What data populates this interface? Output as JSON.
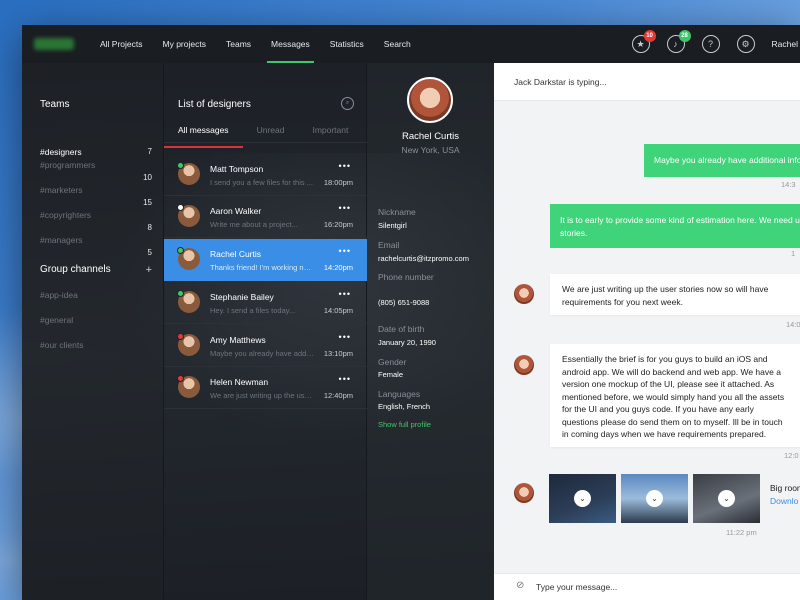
{
  "nav": {
    "items": [
      "All Projects",
      "My projects",
      "Teams",
      "Messages",
      "Statistics",
      "Search"
    ],
    "active_index": 3,
    "badges": {
      "star": "10",
      "bell": "28"
    },
    "badge_colors": {
      "star": "#e53935",
      "bell": "#3ec76a"
    },
    "icons": [
      "star-icon",
      "bell-icon",
      "help-icon",
      "settings-icon"
    ],
    "user": "Rachel"
  },
  "teams": {
    "title": "Teams",
    "items": [
      {
        "name": "#designers",
        "count": "7"
      },
      {
        "name": "#programmers",
        "count": "10"
      },
      {
        "name": "#marketers",
        "count": "15"
      },
      {
        "name": "#copyrighters",
        "count": "8"
      },
      {
        "name": "#managers",
        "count": "5"
      }
    ],
    "active_index": 0,
    "group_title": "Group channels",
    "channels": [
      "#app-idea",
      "#general",
      "#our clients"
    ]
  },
  "designers": {
    "title": "List of designers",
    "tabs": [
      "All messages",
      "Unread",
      "Important"
    ],
    "messages": [
      {
        "name": "Matt Tompson",
        "preview": "I send you a few files for this ...",
        "time": "18:00pm",
        "status": "#3ec76a"
      },
      {
        "name": "Aaron Walker",
        "preview": "Write me about a project...",
        "time": "16:20pm",
        "status": "#ffffff"
      },
      {
        "name": "Rachel Curtis",
        "preview": "Thanks friend! I'm working now...",
        "time": "14:20pm",
        "status": "#3ec76a"
      },
      {
        "name": "Stephanie Bailey",
        "preview": "Hey. I send a files today...",
        "time": "14:05pm",
        "status": "#3ec76a"
      },
      {
        "name": "Amy Matthews",
        "preview": "Maybe you already have addit...",
        "time": "13:10pm",
        "status": "#e53935"
      },
      {
        "name": "Helen Newman",
        "preview": "We are just writing up the user...",
        "time": "12:40pm",
        "status": "#e53935"
      }
    ],
    "active_index": 2
  },
  "profile": {
    "name": "Rachel Curtis",
    "location": "New York, USA",
    "fields": [
      {
        "label": "Nickname",
        "value": "Silentgirl"
      },
      {
        "label": "Email",
        "value": "rachelcurtis@itzpromo.com"
      },
      {
        "label": "Phone number",
        "value": "(805) 651-9088"
      },
      {
        "label": "Date of birth",
        "value": "January 20, 1990"
      },
      {
        "label": "Gender",
        "value": "Female"
      },
      {
        "label": "Languages",
        "value": "English, French"
      }
    ],
    "link": "Show full profile"
  },
  "chat": {
    "typing": "Jack Darkstar is typing...",
    "out1": "Maybe you already have additional info",
    "out1_time": "14:3",
    "out2_line1": "It is to early to provide some kind of estimation here. We need u",
    "out2_line2": "stories.",
    "out2_time": "",
    "in1": "We are just writing up the user stories now so will have requirements for you next week.",
    "in1_time": "14:0",
    "in2": "Essentially the brief is for you guys to build an iOS and android app. We will do backend and web app. We have a version one mockup of the UI, please see it attached. As mentioned before, we would simply hand you all the assets for the UI and you guys code. If you have any early questions please do send them on to myself. Ill be in touch in coming days when we have requirements prepared.",
    "in2_time": "12:0",
    "attachment_name": "Big room",
    "attachment_action": "Downlo",
    "attachment_time": "11:22 pm",
    "input_placeholder": "Type your message..."
  }
}
